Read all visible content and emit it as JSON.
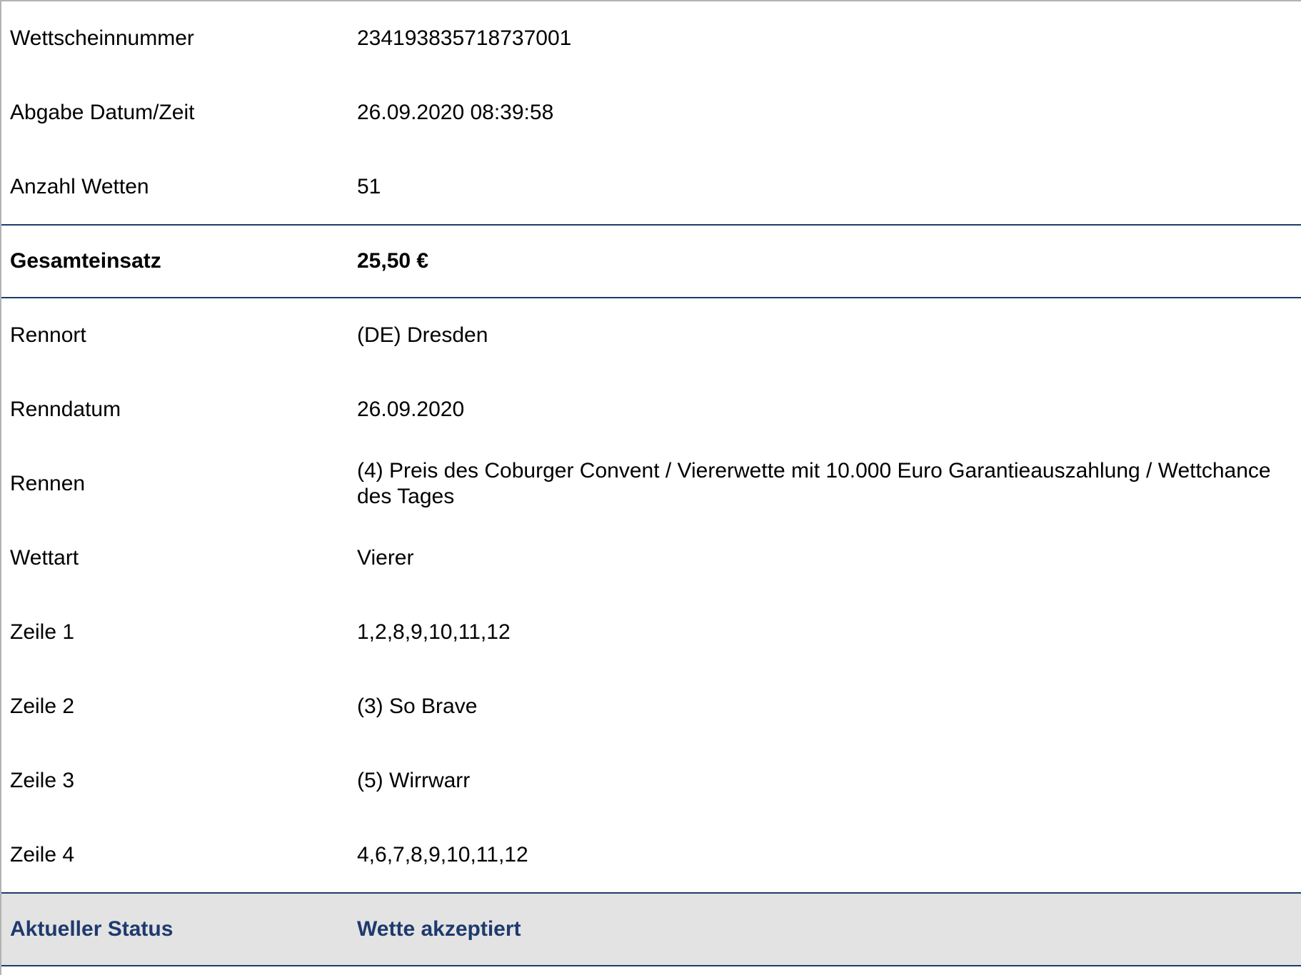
{
  "ticket": {
    "rows": [
      {
        "label": "Wettscheinnummer",
        "value": "234193835718737001"
      },
      {
        "label": "Abgabe Datum/Zeit",
        "value": "26.09.2020 08:39:58"
      },
      {
        "label": "Anzahl Wetten",
        "value": "51"
      }
    ],
    "total": {
      "label": "Gesamteinsatz",
      "value": "25,50 €"
    },
    "race_rows": [
      {
        "label": "Rennort",
        "value": "(DE) Dresden"
      },
      {
        "label": "Renndatum",
        "value": "26.09.2020"
      },
      {
        "label": "Rennen",
        "value": "(4) Preis des Coburger Convent / Viererwette mit 10.000 Euro Garantieauszahlung / Wettchance des Tages"
      },
      {
        "label": "Wettart",
        "value": "Vierer"
      },
      {
        "label": "Zeile 1",
        "value": "1,2,8,9,10,11,12"
      },
      {
        "label": "Zeile 2",
        "value": "(3) So Brave"
      },
      {
        "label": "Zeile 3",
        "value": "(5) Wirrwarr"
      },
      {
        "label": "Zeile 4",
        "value": "4,6,7,8,9,10,11,12"
      }
    ],
    "status": {
      "label": "Aktueller Status",
      "value": "Wette akzeptiert"
    }
  },
  "colors": {
    "accent": "#1e3a6e",
    "status_background": "#e3e3e3",
    "outer_border": "#b3b3b3"
  }
}
